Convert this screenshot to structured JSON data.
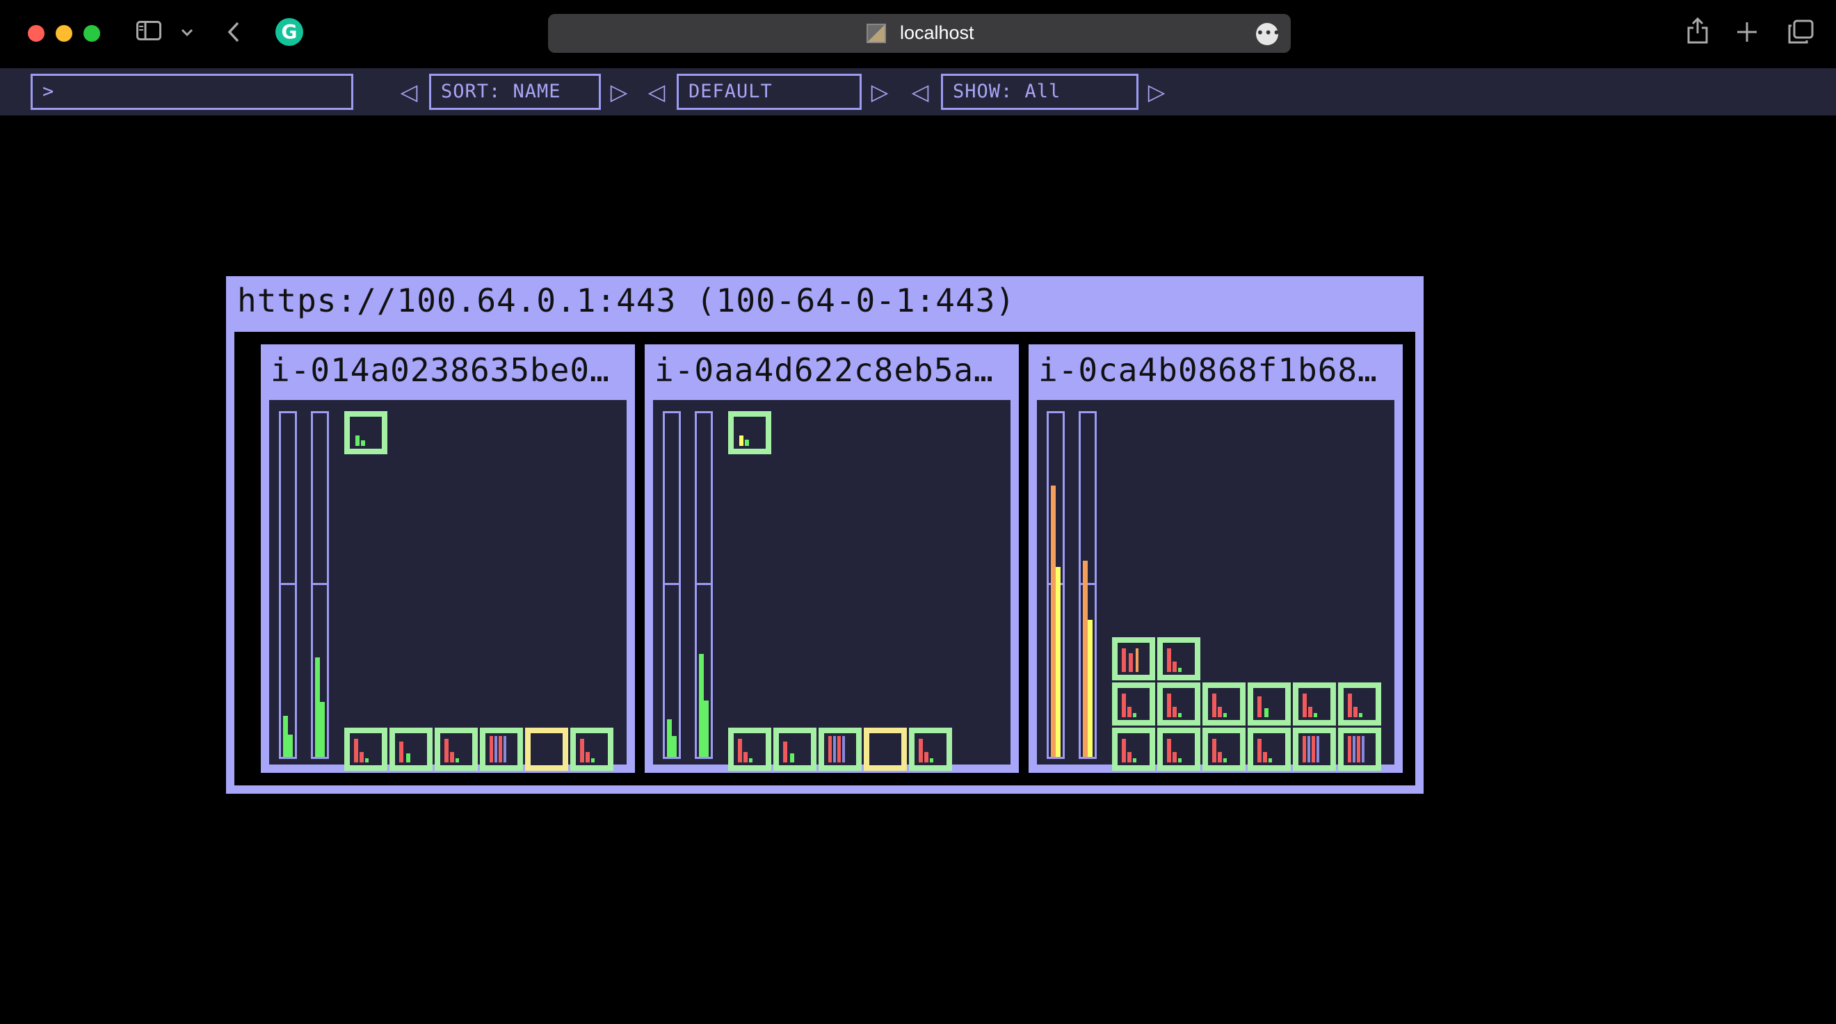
{
  "browser": {
    "url": "localhost",
    "icons": {
      "sidebar": "sidebar-icon",
      "chevron": "chevron-down-icon",
      "back": "back-icon",
      "extension": "grammarly-icon",
      "share": "share-icon",
      "new_tab": "plus-icon",
      "tabs": "tabs-icon",
      "more": "more-icon"
    }
  },
  "toolbar": {
    "filter_value": ">",
    "sort_label": "SORT: NAME",
    "preset_label": "DEFAULT",
    "show_label": "SHOW: All",
    "prev_glyph": "◁",
    "next_glyph": "▷"
  },
  "colors": {
    "panel": "#a8a6f9",
    "cell_ok": "#a6f0a6",
    "cell_warn": "#f5ea92",
    "red": "#f05a5a",
    "green": "#66ee66",
    "yellow": "#ffff66",
    "orange": "#f5a05a"
  },
  "server": {
    "title": "https://100.64.0.1:443 (100-64-0-1:443)",
    "nodes": [
      {
        "title": "i-014a0238635be0…",
        "bar1_level": 0.12,
        "bar2_level": 0.29,
        "cells": [
          {
            "row": 0,
            "col": 0,
            "status": "ok",
            "pattern": "g"
          },
          {
            "row": 7,
            "col": 0,
            "status": "ok",
            "pattern": "r"
          },
          {
            "row": 7,
            "col": 1,
            "status": "ok",
            "pattern": "rg"
          },
          {
            "row": 7,
            "col": 2,
            "status": "ok",
            "pattern": "r"
          },
          {
            "row": 7,
            "col": 3,
            "status": "ok",
            "pattern": "rb"
          },
          {
            "row": 7,
            "col": 4,
            "status": "warn",
            "pattern": "empty"
          },
          {
            "row": 7,
            "col": 5,
            "status": "ok",
            "pattern": "r"
          }
        ]
      },
      {
        "title": "i-0aa4d622c8eb5a…",
        "bar1_level": 0.11,
        "bar2_level": 0.3,
        "cells": [
          {
            "row": 0,
            "col": 0,
            "status": "ok",
            "pattern": "y"
          },
          {
            "row": 7,
            "col": 0,
            "status": "ok",
            "pattern": "r"
          },
          {
            "row": 7,
            "col": 1,
            "status": "ok",
            "pattern": "rg"
          },
          {
            "row": 7,
            "col": 2,
            "status": "ok",
            "pattern": "rb"
          },
          {
            "row": 7,
            "col": 3,
            "status": "warn",
            "pattern": "empty"
          },
          {
            "row": 7,
            "col": 4,
            "status": "ok",
            "pattern": "r"
          }
        ]
      },
      {
        "title": "i-0ca4b0868f1b68…",
        "bar1_level": 0.79,
        "bar2_level": 0.57,
        "cells": [
          {
            "row": 5,
            "col": 0,
            "status": "ok",
            "pattern": "rr"
          },
          {
            "row": 5,
            "col": 1,
            "status": "ok",
            "pattern": "r"
          },
          {
            "row": 6,
            "col": 0,
            "status": "ok",
            "pattern": "r"
          },
          {
            "row": 6,
            "col": 1,
            "status": "ok",
            "pattern": "r"
          },
          {
            "row": 6,
            "col": 2,
            "status": "ok",
            "pattern": "r"
          },
          {
            "row": 6,
            "col": 3,
            "status": "ok",
            "pattern": "rg"
          },
          {
            "row": 6,
            "col": 4,
            "status": "ok",
            "pattern": "r"
          },
          {
            "row": 6,
            "col": 5,
            "status": "ok",
            "pattern": "r"
          },
          {
            "row": 7,
            "col": 0,
            "status": "ok",
            "pattern": "r"
          },
          {
            "row": 7,
            "col": 1,
            "status": "ok",
            "pattern": "r"
          },
          {
            "row": 7,
            "col": 2,
            "status": "ok",
            "pattern": "r"
          },
          {
            "row": 7,
            "col": 3,
            "status": "ok",
            "pattern": "r"
          },
          {
            "row": 7,
            "col": 4,
            "status": "ok",
            "pattern": "rb"
          },
          {
            "row": 7,
            "col": 5,
            "status": "ok",
            "pattern": "rb"
          }
        ]
      }
    ]
  }
}
